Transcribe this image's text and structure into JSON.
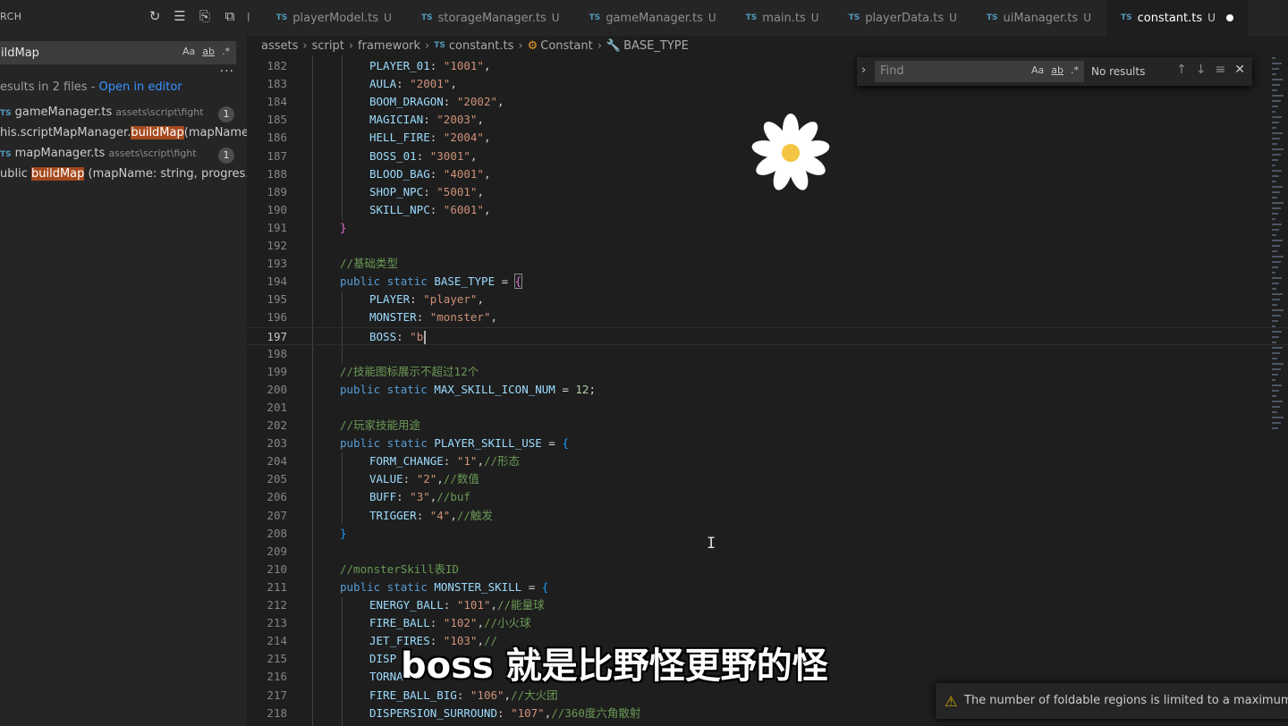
{
  "sidebar": {
    "title": "RCH",
    "search_value": "ildMap",
    "search_opts": [
      "Aa",
      "ab",
      ".*"
    ],
    "results_summary": "esults in 2 files - ",
    "open_in_editor": "Open in editor",
    "files": [
      {
        "name": "gameManager.ts",
        "path": "assets\\script\\fight",
        "count": "1",
        "match_pre": "his.scriptMapManager.",
        "match_hl": "buildMap",
        "match_post": "(mapName..."
      },
      {
        "name": "mapManager.ts",
        "path": "assets\\script\\fight",
        "count": "1",
        "match_pre": "ublic ",
        "match_hl": "buildMap",
        "match_post": " (mapName: string, progres..."
      }
    ]
  },
  "tabs": [
    {
      "label": "l",
      "badge": "",
      "active": false
    },
    {
      "label": "playerModel.ts",
      "badge": "U",
      "active": false
    },
    {
      "label": "storageManager.ts",
      "badge": "U",
      "active": false
    },
    {
      "label": "gameManager.ts",
      "badge": "U",
      "active": false
    },
    {
      "label": "main.ts",
      "badge": "U",
      "active": false
    },
    {
      "label": "playerData.ts",
      "badge": "U",
      "active": false
    },
    {
      "label": "uiManager.ts",
      "badge": "U",
      "active": false
    },
    {
      "label": "constant.ts",
      "badge": "U",
      "active": true
    }
  ],
  "breadcrumb": {
    "parts": [
      "assets",
      "script",
      "framework"
    ],
    "file": "constant.ts",
    "class": "Constant",
    "member": "BASE_TYPE"
  },
  "find": {
    "placeholder": "Find",
    "opts": [
      "Aa",
      "ab",
      ".*"
    ],
    "result": "No results"
  },
  "code": [
    {
      "n": "182",
      "i": 1,
      "t": [
        [
          "k",
          "PLAYER_01"
        ],
        [
          "p",
          ": "
        ],
        [
          "s",
          "\"1001\""
        ],
        [
          "p",
          ","
        ]
      ]
    },
    {
      "n": "183",
      "i": 1,
      "t": [
        [
          "k",
          "AULA"
        ],
        [
          "p",
          ": "
        ],
        [
          "s",
          "\"2001\""
        ],
        [
          "p",
          ","
        ]
      ]
    },
    {
      "n": "184",
      "i": 1,
      "t": [
        [
          "k",
          "BOOM_DRAGON"
        ],
        [
          "p",
          ": "
        ],
        [
          "s",
          "\"2002\""
        ],
        [
          "p",
          ","
        ]
      ]
    },
    {
      "n": "185",
      "i": 1,
      "t": [
        [
          "k",
          "MAGICIAN"
        ],
        [
          "p",
          ": "
        ],
        [
          "s",
          "\"2003\""
        ],
        [
          "p",
          ","
        ]
      ]
    },
    {
      "n": "186",
      "i": 1,
      "t": [
        [
          "k",
          "HELL_FIRE"
        ],
        [
          "p",
          ": "
        ],
        [
          "s",
          "\"2004\""
        ],
        [
          "p",
          ","
        ]
      ]
    },
    {
      "n": "187",
      "i": 1,
      "t": [
        [
          "k",
          "BOSS_01"
        ],
        [
          "p",
          ": "
        ],
        [
          "s",
          "\"3001\""
        ],
        [
          "p",
          ","
        ]
      ]
    },
    {
      "n": "188",
      "i": 1,
      "t": [
        [
          "k",
          "BLOOD_BAG"
        ],
        [
          "p",
          ": "
        ],
        [
          "s",
          "\"4001\""
        ],
        [
          "p",
          ","
        ]
      ]
    },
    {
      "n": "189",
      "i": 1,
      "t": [
        [
          "k",
          "SHOP_NPC"
        ],
        [
          "p",
          ": "
        ],
        [
          "s",
          "\"5001\""
        ],
        [
          "p",
          ","
        ]
      ]
    },
    {
      "n": "190",
      "i": 1,
      "t": [
        [
          "k",
          "SKILL_NPC"
        ],
        [
          "p",
          ": "
        ],
        [
          "s",
          "\"6001\""
        ],
        [
          "p",
          ","
        ]
      ]
    },
    {
      "n": "191",
      "i": 0,
      "t": [
        [
          "b1",
          "}"
        ]
      ]
    },
    {
      "n": "192",
      "i": 0,
      "t": []
    },
    {
      "n": "193",
      "i": 0,
      "t": [
        [
          "c",
          "//基础类型"
        ]
      ]
    },
    {
      "n": "194",
      "i": 0,
      "t": [
        [
          "kw",
          "public static "
        ],
        [
          "k",
          "BASE_TYPE"
        ],
        [
          "p",
          " = "
        ],
        [
          "b1",
          "{"
        ]
      ]
    },
    {
      "n": "195",
      "i": 1,
      "t": [
        [
          "k",
          "PLAYER"
        ],
        [
          "p",
          ": "
        ],
        [
          "s",
          "\"player\""
        ],
        [
          "p",
          ","
        ]
      ]
    },
    {
      "n": "196",
      "i": 1,
      "t": [
        [
          "k",
          "MONSTER"
        ],
        [
          "p",
          ": "
        ],
        [
          "s",
          "\"monster\""
        ],
        [
          "p",
          ","
        ]
      ]
    },
    {
      "n": "197",
      "i": 1,
      "t": [
        [
          "k",
          "BOSS"
        ],
        [
          "p",
          ": "
        ],
        [
          "s",
          "\"b"
        ]
      ],
      "cur": true
    },
    {
      "n": "198",
      "i": 0,
      "t": []
    },
    {
      "n": "199",
      "i": 0,
      "t": [
        [
          "c",
          "//技能图标展示不超过12个"
        ]
      ]
    },
    {
      "n": "200",
      "i": 0,
      "t": [
        [
          "kw",
          "public static "
        ],
        [
          "k",
          "MAX_SKILL_ICON_NUM"
        ],
        [
          "p",
          " = "
        ],
        [
          "num",
          "12"
        ],
        [
          "p",
          ";"
        ]
      ]
    },
    {
      "n": "201",
      "i": 0,
      "t": []
    },
    {
      "n": "202",
      "i": 0,
      "t": [
        [
          "c",
          "//玩家技能用途"
        ]
      ]
    },
    {
      "n": "203",
      "i": 0,
      "t": [
        [
          "kw",
          "public static "
        ],
        [
          "k",
          "PLAYER_SKILL_USE"
        ],
        [
          "p",
          " = "
        ],
        [
          "b2",
          "{"
        ]
      ]
    },
    {
      "n": "204",
      "i": 1,
      "t": [
        [
          "k",
          "FORM_CHANGE"
        ],
        [
          "p",
          ": "
        ],
        [
          "s",
          "\"1\""
        ],
        [
          "p",
          ","
        ],
        [
          "c",
          "//形态"
        ]
      ]
    },
    {
      "n": "205",
      "i": 1,
      "t": [
        [
          "k",
          "VALUE"
        ],
        [
          "p",
          ": "
        ],
        [
          "s",
          "\"2\""
        ],
        [
          "p",
          ","
        ],
        [
          "c",
          "//数值"
        ]
      ]
    },
    {
      "n": "206",
      "i": 1,
      "t": [
        [
          "k",
          "BUFF"
        ],
        [
          "p",
          ": "
        ],
        [
          "s",
          "\"3\""
        ],
        [
          "p",
          ","
        ],
        [
          "c",
          "//buf"
        ]
      ]
    },
    {
      "n": "207",
      "i": 1,
      "t": [
        [
          "k",
          "TRIGGER"
        ],
        [
          "p",
          ": "
        ],
        [
          "s",
          "\"4\""
        ],
        [
          "p",
          ","
        ],
        [
          "c",
          "//触发"
        ]
      ]
    },
    {
      "n": "208",
      "i": 0,
      "t": [
        [
          "b2",
          "}"
        ]
      ]
    },
    {
      "n": "209",
      "i": 0,
      "t": []
    },
    {
      "n": "210",
      "i": 0,
      "t": [
        [
          "c",
          "//monsterSkill表ID"
        ]
      ]
    },
    {
      "n": "211",
      "i": 0,
      "t": [
        [
          "kw",
          "public static "
        ],
        [
          "k",
          "MONSTER_SKILL"
        ],
        [
          "p",
          " = "
        ],
        [
          "b2",
          "{"
        ]
      ]
    },
    {
      "n": "212",
      "i": 1,
      "t": [
        [
          "k",
          "ENERGY_BALL"
        ],
        [
          "p",
          ": "
        ],
        [
          "s",
          "\"101\""
        ],
        [
          "p",
          ","
        ],
        [
          "c",
          "//能量球"
        ]
      ]
    },
    {
      "n": "213",
      "i": 1,
      "t": [
        [
          "k",
          "FIRE_BALL"
        ],
        [
          "p",
          ": "
        ],
        [
          "s",
          "\"102\""
        ],
        [
          "p",
          ","
        ],
        [
          "c",
          "//小火球"
        ]
      ]
    },
    {
      "n": "214",
      "i": 1,
      "t": [
        [
          "k",
          "JET_FIRES"
        ],
        [
          "p",
          ": "
        ],
        [
          "s",
          "\"103\""
        ],
        [
          "p",
          ","
        ],
        [
          "c",
          "//"
        ]
      ]
    },
    {
      "n": "215",
      "i": 1,
      "t": [
        [
          "k",
          "DISP"
        ]
      ]
    },
    {
      "n": "216",
      "i": 1,
      "t": [
        [
          "k",
          "TORNA"
        ]
      ]
    },
    {
      "n": "217",
      "i": 1,
      "t": [
        [
          "k",
          "FIRE_BALL_BIG"
        ],
        [
          "p",
          ": "
        ],
        [
          "s",
          "\"106\""
        ],
        [
          "p",
          ","
        ],
        [
          "c",
          "//大火团"
        ]
      ]
    },
    {
      "n": "218",
      "i": 1,
      "t": [
        [
          "k",
          "DISPERSION_SURROUND"
        ],
        [
          "p",
          ": "
        ],
        [
          "s",
          "\"107\""
        ],
        [
          "p",
          ","
        ],
        [
          "c",
          "//360度六角散射"
        ]
      ]
    }
  ],
  "subtitle": "boss 就是比野怪更野的怪",
  "notification": "The number of foldable regions is limited to a maximum of"
}
